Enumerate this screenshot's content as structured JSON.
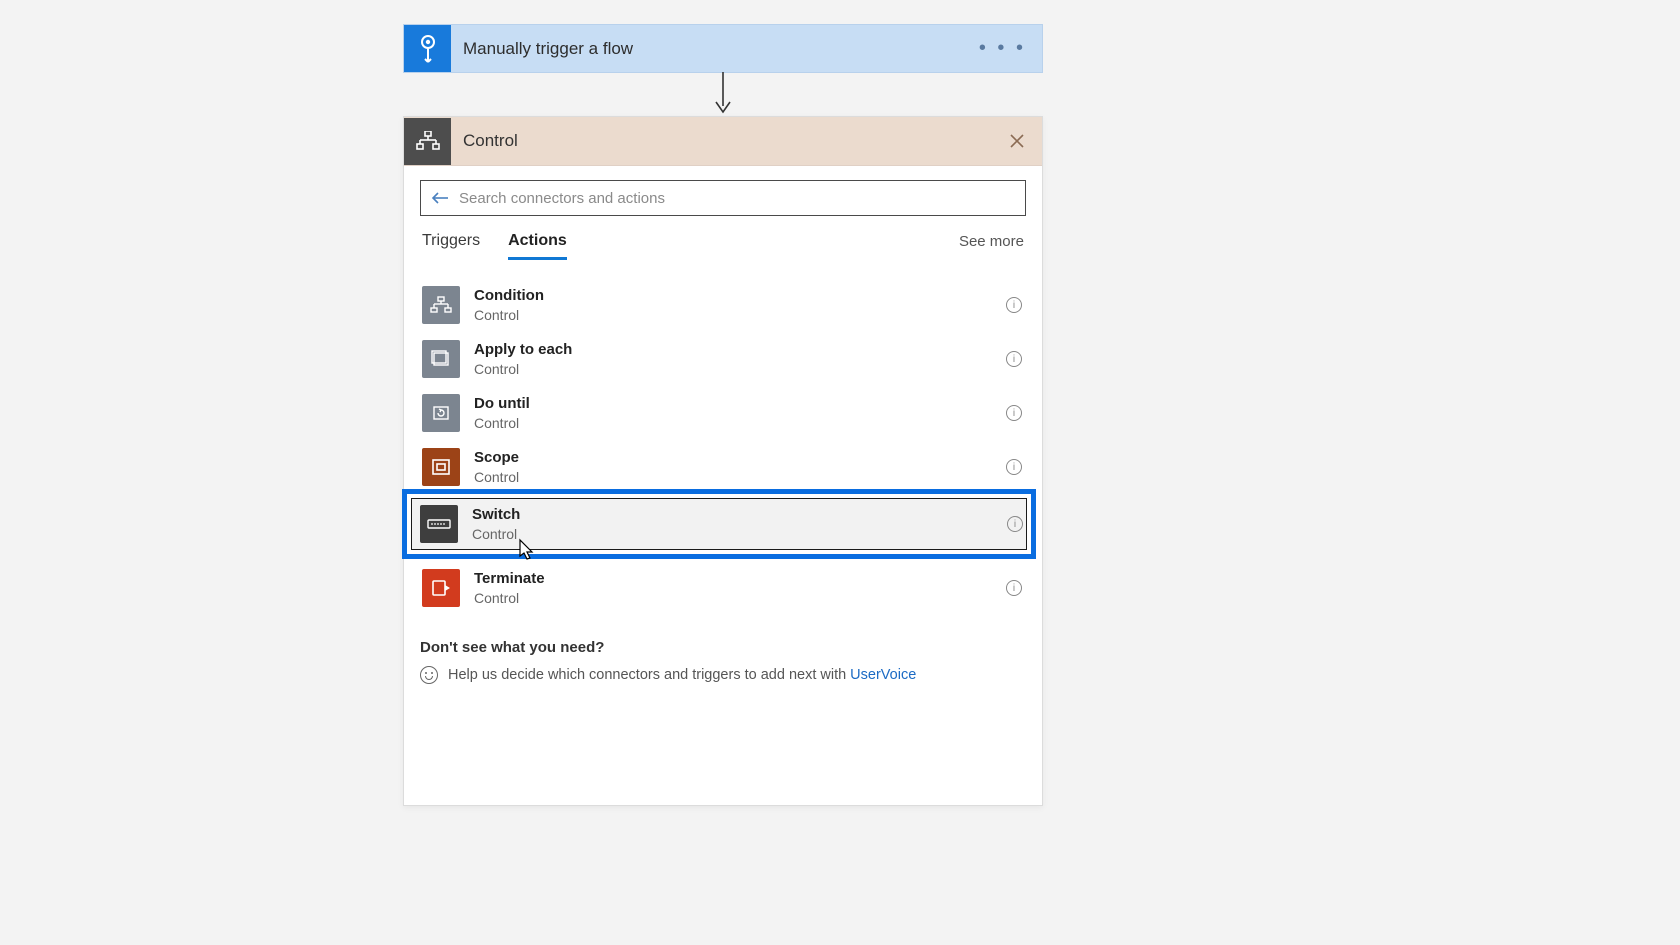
{
  "trigger": {
    "label": "Manually trigger a flow"
  },
  "panel": {
    "title": "Control",
    "search_placeholder": "Search connectors and actions",
    "tabs": {
      "triggers": "Triggers",
      "actions": "Actions",
      "see_more": "See more"
    },
    "actions": [
      {
        "title": "Condition",
        "subtitle": "Control",
        "icon_class": "ic-gray",
        "name": "condition"
      },
      {
        "title": "Apply to each",
        "subtitle": "Control",
        "icon_class": "ic-gray",
        "name": "apply-to-each"
      },
      {
        "title": "Do until",
        "subtitle": "Control",
        "icon_class": "ic-gray",
        "name": "do-until"
      },
      {
        "title": "Scope",
        "subtitle": "Control",
        "icon_class": "ic-brown",
        "name": "scope"
      },
      {
        "title": "Switch",
        "subtitle": "Control",
        "icon_class": "ic-dark",
        "name": "switch",
        "highlighted": true
      },
      {
        "title": "Terminate",
        "subtitle": "Control",
        "icon_class": "ic-red",
        "name": "terminate"
      }
    ],
    "help": {
      "question": "Don't see what you need?",
      "line_prefix": "Help us decide which connectors and triggers to add next with",
      "link": "UserVoice"
    }
  }
}
